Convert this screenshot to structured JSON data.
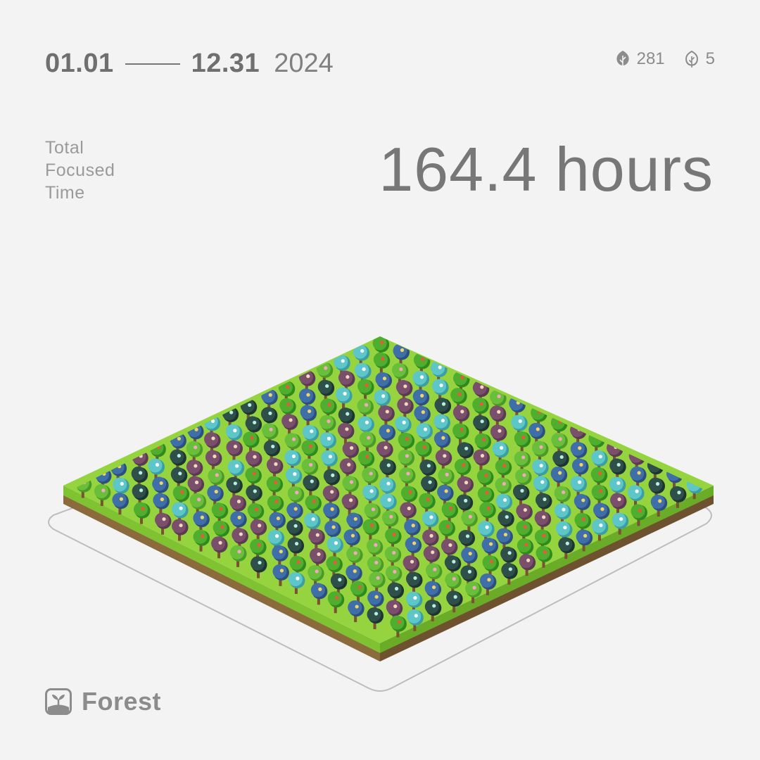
{
  "period": {
    "start": "01.01",
    "end": "12.31",
    "year": "2024"
  },
  "stats": {
    "healthy_trees": "281",
    "dead_trees": "5",
    "healthy_icon": "tree-leaf-icon",
    "dead_icon": "withered-leaf-icon"
  },
  "summary": {
    "label": "Total Focused Time",
    "value": "164.4 hours"
  },
  "brand": {
    "name": "Forest",
    "icon": "forest-logo-icon"
  },
  "colors": {
    "background": "#f3f3f3",
    "text": "#777777",
    "grass": "#8fd63a",
    "soil": "#8b6a3c"
  }
}
